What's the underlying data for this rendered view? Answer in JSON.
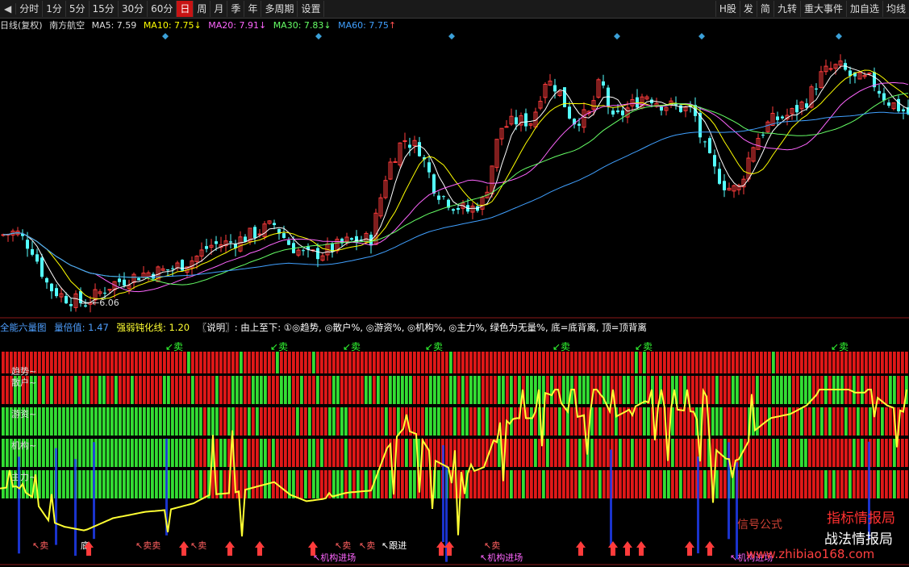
{
  "toolbar": {
    "back_icon": "back-arrow-icon",
    "periods": [
      "分时",
      "1分",
      "5分",
      "15分",
      "30分",
      "60分",
      "日",
      "周",
      "月",
      "季",
      "年",
      "多周期",
      "设置"
    ],
    "active_period": "日",
    "right_buttons": [
      "H股",
      "发",
      "简",
      "九转",
      "重大事件",
      "加自选",
      "均线"
    ]
  },
  "chart_header": {
    "period": "日线(复权)",
    "stock": "南方航空",
    "ma5": "MA5: 7.59",
    "ma10": "MA10: 7.75",
    "ma20": "MA20: 7.91",
    "ma30": "MA30: 7.83",
    "ma60": "MA60: 7.75",
    "down_mark": "↓",
    "up_mark": "↑"
  },
  "indicator_header": {
    "name": "全能六量图",
    "ratio": "量倍值: 1.47",
    "weak_strong": "强弱钝化线: 1.20",
    "note": "〖说明〗: 由上至下: ①◎趋势, ◎散户%, ◎游资%, ◎机构%, ◎主力%, 绿色为无量%, 底=底背离, 顶=顶背离"
  },
  "colors": {
    "up": "#ff3c3c",
    "down": "#54ffff",
    "ma5": "#ffffff",
    "ma10": "#ffff00",
    "ma20": "#ff66ff",
    "ma30": "#66ff66",
    "ma60": "#40a0ff",
    "band_red": "#e01818",
    "band_green": "#33dd33",
    "yellow_line": "#ffff33"
  },
  "chart_data": {
    "type": "candlestick",
    "low_label": "6.06",
    "band_labels": [
      "趋势",
      "散户",
      "游资",
      "机构",
      "主力"
    ],
    "sell_label": "卖",
    "signal_labels": [
      "跟进",
      "机构进场",
      "底"
    ],
    "watermarks": [
      "指标情报局",
      "战法情报局",
      "信号公式",
      "www.zhibiao168.com"
    ]
  }
}
